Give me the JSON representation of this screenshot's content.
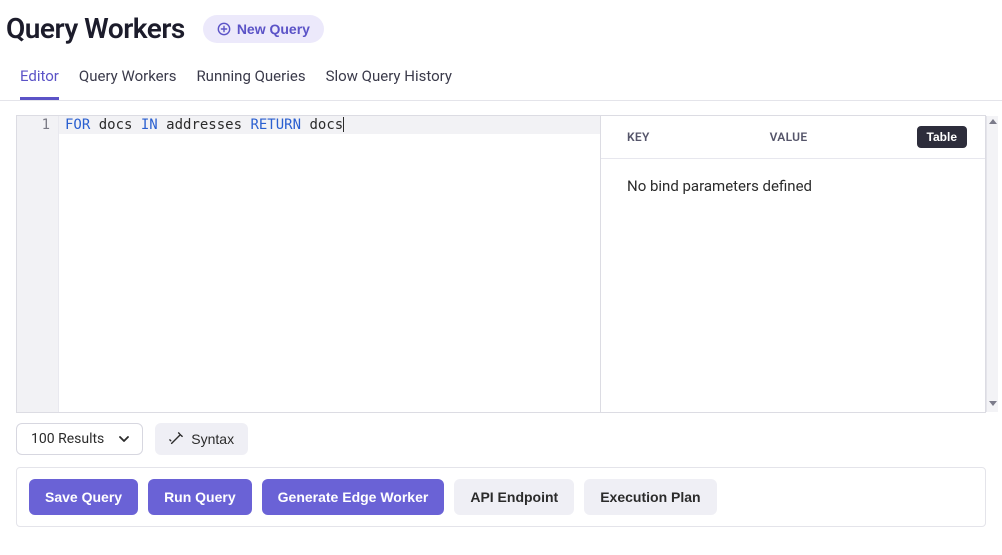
{
  "header": {
    "title": "Query Workers",
    "new_query_label": "New Query"
  },
  "tabs": [
    {
      "label": "Editor",
      "active": true
    },
    {
      "label": "Query Workers",
      "active": false
    },
    {
      "label": "Running Queries",
      "active": false
    },
    {
      "label": "Slow Query History",
      "active": false
    }
  ],
  "editor": {
    "line_number": "1",
    "tokens": [
      {
        "t": "FOR",
        "kw": true
      },
      {
        "t": " docs ",
        "kw": false
      },
      {
        "t": "IN",
        "kw": true
      },
      {
        "t": " addresses ",
        "kw": false
      },
      {
        "t": "RETURN",
        "kw": true
      },
      {
        "t": " docs",
        "kw": false
      }
    ]
  },
  "bind_panel": {
    "key_header": "KEY",
    "value_header": "VALUE",
    "mode_button": "Table",
    "empty_message": "No bind parameters defined"
  },
  "options": {
    "results_label": "100 Results",
    "syntax_label": "Syntax"
  },
  "actions": {
    "save": "Save Query",
    "run": "Run Query",
    "edge": "Generate Edge Worker",
    "api": "API Endpoint",
    "plan": "Execution Plan"
  }
}
